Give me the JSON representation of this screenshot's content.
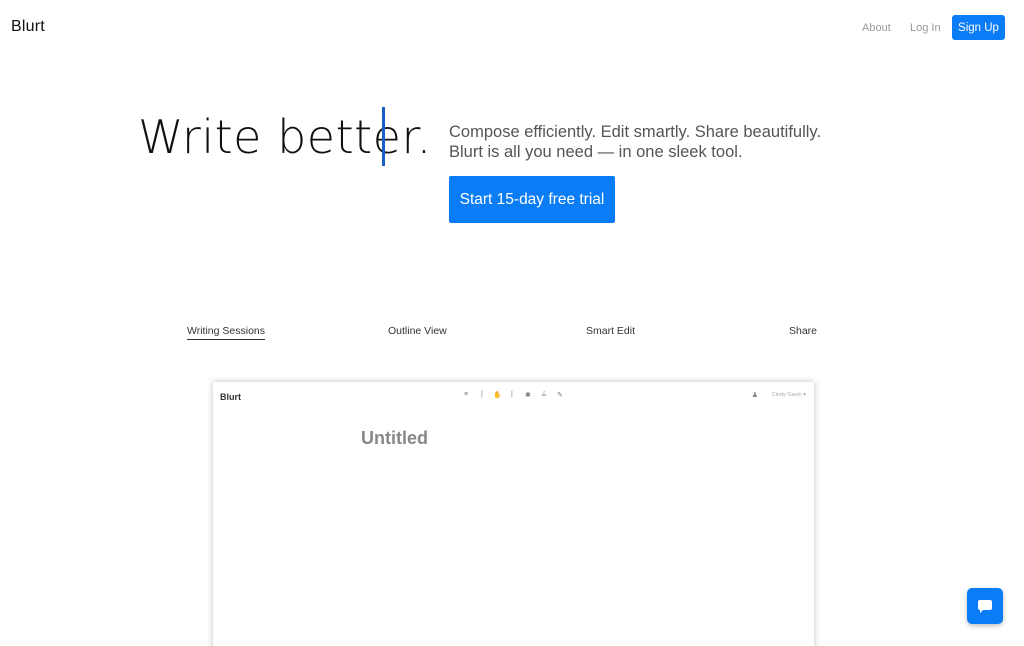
{
  "header": {
    "logo": "Blurt",
    "nav": {
      "about": "About",
      "login": "Log In",
      "signup": "Sign Up"
    }
  },
  "hero": {
    "title": "Write better.",
    "subtitle_line1": "Compose efficiently. Edit smartly. Share beautifully.",
    "subtitle_line2": "Blurt is all you need — in one sleek tool.",
    "cta": "Start 15-day free trial"
  },
  "tabs": [
    {
      "label": "Writing Sessions",
      "active": true
    },
    {
      "label": "Outline View",
      "active": false
    },
    {
      "label": "Smart Edit",
      "active": false
    },
    {
      "label": "Share",
      "active": false
    }
  ],
  "preview": {
    "logo": "Blurt",
    "toolbar_icons": [
      "list-icon",
      "divider",
      "hand-icon",
      "divider",
      "asterisk-icon",
      "lines-icon",
      "pen-icon"
    ],
    "user_name": "Cindy Gavin",
    "document_title": "Untitled"
  },
  "colors": {
    "accent": "#0a7cf6",
    "caret": "#1a5fc8"
  }
}
